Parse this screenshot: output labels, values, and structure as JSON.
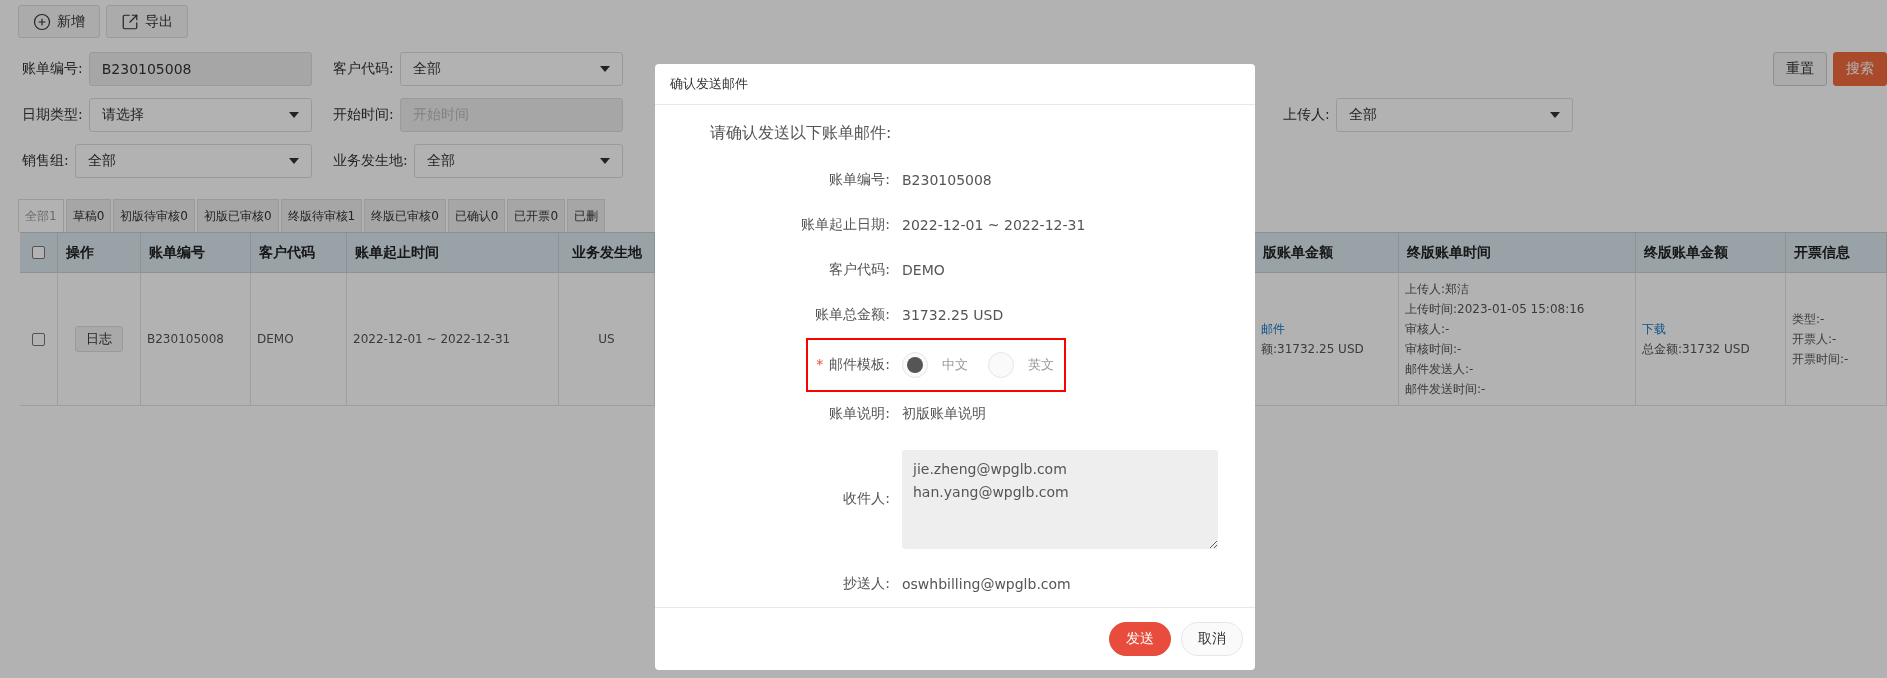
{
  "toolbar": [
    {
      "label": "新增"
    },
    {
      "label": "导出"
    }
  ],
  "filter_rows": [
    {
      "left": [
        {
          "label": "账单编号:",
          "kind": "input",
          "value": "B230105008"
        },
        {
          "label": "客户代码:",
          "kind": "select",
          "value": "全部"
        }
      ],
      "right": [
        {
          "kind": "button",
          "label": "重置",
          "primary": false
        },
        {
          "kind": "button",
          "label": "搜索",
          "primary": true
        }
      ]
    },
    {
      "left": [
        {
          "label": "日期类型:",
          "kind": "select",
          "value": "请选择"
        },
        {
          "label": "开始时间:",
          "kind": "input",
          "placeholder": "开始时间"
        }
      ],
      "right": [
        {
          "kind": "select",
          "label": "上传人:",
          "value": "全部"
        }
      ]
    },
    {
      "left": [
        {
          "label": "销售组:",
          "kind": "select",
          "value": "全部"
        },
        {
          "label": "业务发生地:",
          "kind": "select",
          "value": "全部"
        }
      ],
      "right": []
    }
  ],
  "tabs": [
    {
      "label": "全部1",
      "selected": true
    },
    {
      "label": "草稿0",
      "selected": false
    },
    {
      "label": "初版待审核0",
      "selected": false
    },
    {
      "label": "初版已审核0",
      "selected": false
    },
    {
      "label": "终版待审核1",
      "selected": false
    },
    {
      "label": "终版已审核0",
      "selected": false
    },
    {
      "label": "已确认0",
      "selected": false
    },
    {
      "label": "已开票0",
      "selected": false
    },
    {
      "label": "已删",
      "selected": false
    }
  ],
  "table": {
    "header_checkbox": {
      "checked": false
    },
    "columns_left": [
      "操作",
      "账单编号",
      "客户代码",
      "账单起止时间",
      "业务发生地"
    ],
    "columns_right": [
      "版账单金额",
      "终版账单时间",
      "终版账单金额",
      "开票信息"
    ],
    "rows": [
      {
        "checked": false,
        "action": "日志",
        "cells_left": [
          "B230105008",
          "DEMO",
          "2022-12-01 ~ 2022-12-31",
          "US"
        ],
        "cells_right": [
          [
            {
              "kind": "link",
              "text": "邮件"
            },
            {
              "kind": "text",
              "text": "额:31732.25 USD"
            }
          ],
          [
            {
              "kind": "text",
              "text": "上传人:郑洁"
            },
            {
              "kind": "text",
              "text": "上传时间:2023-01-05 15:08:16"
            },
            {
              "kind": "text",
              "text": "审核人:-"
            },
            {
              "kind": "text",
              "text": "审核时间:-"
            },
            {
              "kind": "text",
              "text": "邮件发送人:-"
            },
            {
              "kind": "text",
              "text": "邮件发送时间:-"
            }
          ],
          [
            {
              "kind": "link",
              "text": "下载"
            },
            {
              "kind": "text",
              "text": "总金额:31732 USD"
            }
          ],
          [
            {
              "kind": "text",
              "text": "类型:-"
            },
            {
              "kind": "text",
              "text": "开票人:-"
            },
            {
              "kind": "text",
              "text": "开票时间:-"
            }
          ]
        ]
      }
    ]
  },
  "dialog": {
    "title": "确认发送邮件",
    "intro": "请确认发送以下账单邮件:",
    "fields": [
      {
        "kind": "text",
        "label": "账单编号:",
        "value": "B230105008"
      },
      {
        "kind": "text",
        "label": "账单起止日期:",
        "value": "2022-12-01 ~ 2022-12-31"
      },
      {
        "kind": "text",
        "label": "客户代码:",
        "value": "DEMO"
      },
      {
        "kind": "text",
        "label": "账单总金额:",
        "value": "31732.25 USD"
      },
      {
        "kind": "radio",
        "label": "邮件模板:",
        "required_mark": "*",
        "highlighted": true,
        "options": [
          {
            "label": "中文",
            "selected": true
          },
          {
            "label": "英文",
            "selected": false
          }
        ]
      },
      {
        "kind": "text",
        "label": "账单说明:",
        "value": "初版账单说明"
      },
      {
        "kind": "textarea",
        "label": "收件人:",
        "value": "jie.zheng@wpglb.com\nhan.yang@wpglb.com"
      },
      {
        "kind": "text",
        "label": "抄送人:",
        "value": "oswhbilling@wpglb.com"
      }
    ],
    "buttons": [
      {
        "label": "发送",
        "primary": true
      },
      {
        "label": "取消",
        "primary": false
      }
    ]
  }
}
